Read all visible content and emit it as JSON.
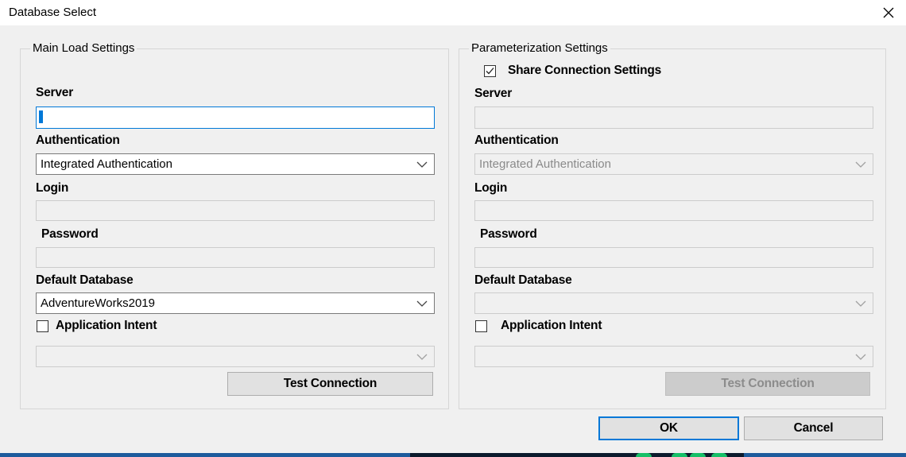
{
  "window": {
    "title": "Database Select",
    "close_icon": "close-icon"
  },
  "main": {
    "legend": "Main Load Settings",
    "server_label": "Server",
    "server_value": "",
    "authentication_label": "Authentication",
    "authentication_value": "Integrated Authentication",
    "login_label": "Login",
    "password_label": "Password",
    "default_database_label": "Default Database",
    "default_database_value": "AdventureWorks2019",
    "application_intent_label": "Application Intent",
    "application_intent_checked": false,
    "test_connection_label": "Test Connection"
  },
  "param": {
    "legend": "Parameterization Settings",
    "share_label": "Share Connection Settings",
    "share_checked": true,
    "server_label": "Server",
    "authentication_label": "Authentication",
    "authentication_value": "Integrated Authentication",
    "login_label": "Login",
    "password_label": "Password",
    "default_database_label": "Default Database",
    "application_intent_label": "Application Intent",
    "application_intent_checked": false,
    "test_connection_label": "Test Connection"
  },
  "footer": {
    "ok_label": "OK",
    "cancel_label": "Cancel"
  },
  "colors": {
    "accent": "#0078d7",
    "dialog_bg": "#f0f0f0",
    "disabled_text": "#8a8a8a"
  }
}
